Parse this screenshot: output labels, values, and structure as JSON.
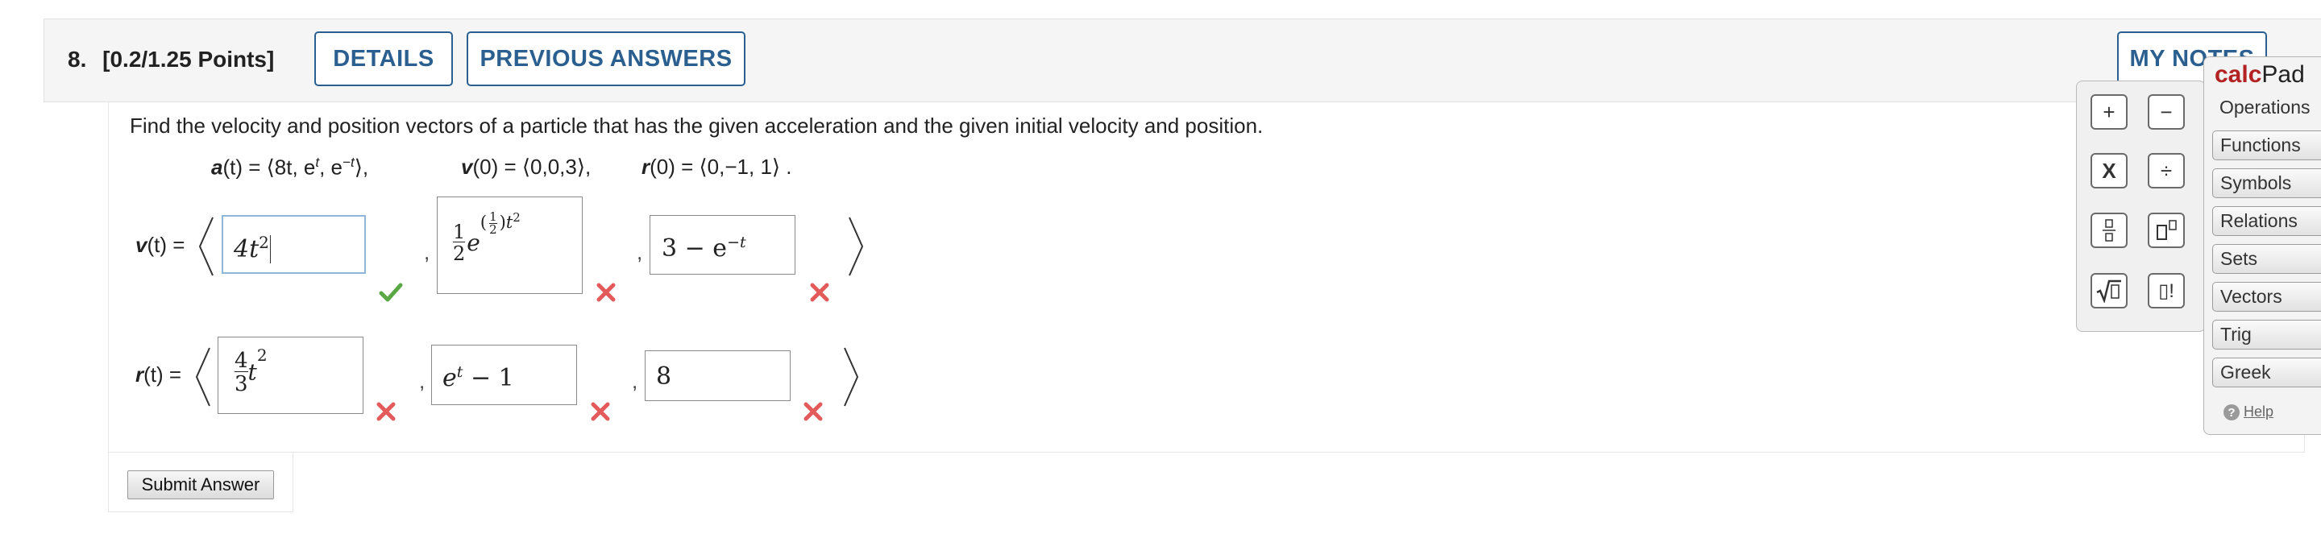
{
  "question": {
    "number": "8.",
    "points": "[0.2/1.25 Points]",
    "details_label": "DETAILS",
    "previous_answers_label": "PREVIOUS ANSWERS",
    "my_notes_label": "MY NOTES",
    "prompt": "Find the velocity and position vectors of a particle that has the given acceleration and the given initial velocity and position.",
    "given": {
      "a_name": "a",
      "a_rest": "(t) = ⟨8t, e",
      "a_exp1": "t",
      "a_mid": ", e",
      "a_exp2": "−t",
      "a_end": "⟩,",
      "v_name": "v",
      "v_rest": "(0) = ⟨0,0,3⟩,",
      "r_name": "r",
      "r_rest": "(0) = ⟨0,−1, 1⟩ ."
    },
    "v_label_name": "v",
    "v_label_rest": "(t) =",
    "r_label_name": "r",
    "r_label_rest": "(t) =",
    "v_answers": {
      "first": {
        "base": "4t",
        "exp": "2",
        "status": "correct"
      },
      "second": {
        "coef_num": "1",
        "coef_den": "2",
        "e": "e",
        "half_num": "1",
        "half_den": "2",
        "t": "t",
        "exp": "2",
        "status": "incorrect"
      },
      "third": {
        "pre": "3 − e",
        "exp": "−t",
        "status": "incorrect"
      }
    },
    "r_answers": {
      "first": {
        "num": "4",
        "den": "3",
        "t": "t",
        "exp": "2",
        "status": "incorrect"
      },
      "second": {
        "e": "e",
        "exp": "t",
        "rest": " − 1",
        "status": "incorrect"
      },
      "third": {
        "value": "8",
        "status": "incorrect"
      }
    },
    "comma": ",",
    "submit_label": "Submit Answer"
  },
  "calcpad": {
    "title_bold": "calc",
    "title_rest": "Pad",
    "category_label": "Operations",
    "categories": [
      "Functions",
      "Symbols",
      "Relations",
      "Sets",
      "Vectors",
      "Trig",
      "Greek"
    ],
    "help_label": "Help",
    "help_icon": "?",
    "buttons": {
      "plus": "+",
      "minus": "−",
      "times": "X",
      "divide": "÷",
      "factorial": "▯!"
    }
  },
  "colors": {
    "accent": "#2a5f8f",
    "correct": "#5aa845",
    "incorrect": "#e35a5a",
    "calcpad_title": "#b22222"
  }
}
